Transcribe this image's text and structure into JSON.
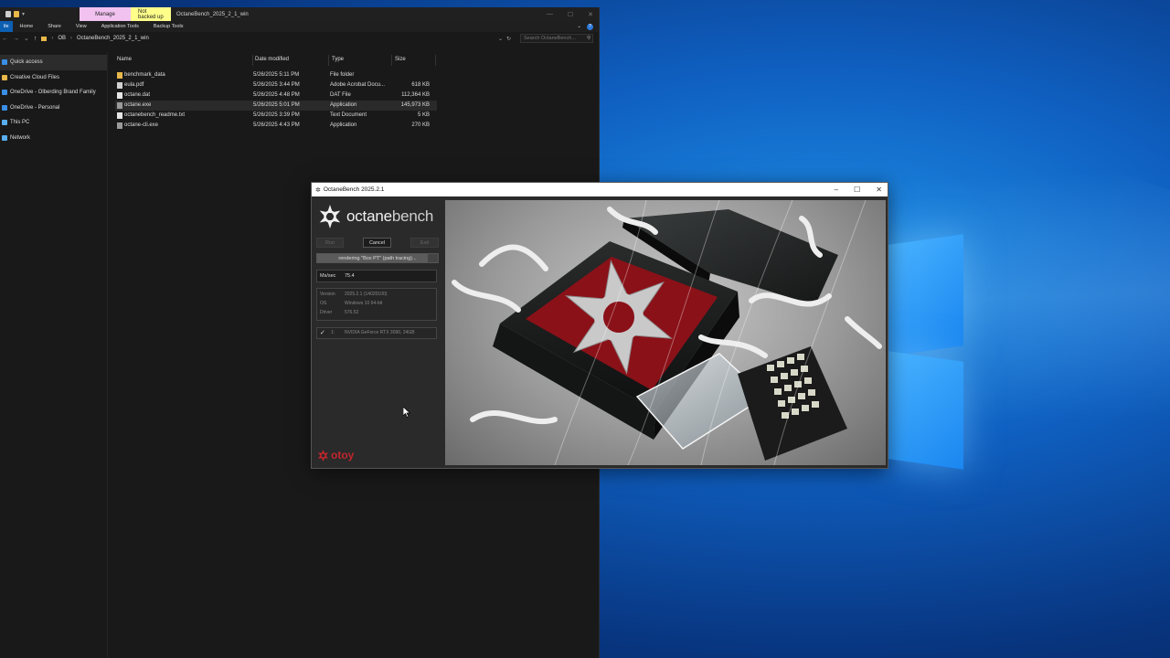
{
  "explorer": {
    "ctx_manage": "Manage",
    "ctx_backup": "Not backed up",
    "window_title": "OctaneBench_2025_2_1_win",
    "ribbon": {
      "file": "ile",
      "tabs": [
        "Home",
        "Share",
        "View",
        "Application Tools",
        "Backup Tools"
      ]
    },
    "address": {
      "root": "OB",
      "folder": "OctaneBench_2025_2_1_win",
      "search_placeholder": "Search OctaneBench..."
    },
    "nav": [
      {
        "label": "Quick access",
        "icon": "star-icon",
        "color": "#3a8ee6"
      },
      {
        "label": "Creative Cloud Files",
        "icon": "folder-icon",
        "color": "#e8b84a"
      },
      {
        "label": "OneDrive - Olberding Brand Family",
        "icon": "cloud-icon",
        "color": "#3a8ee6"
      },
      {
        "label": "OneDrive - Personal",
        "icon": "cloud-icon",
        "color": "#3a8ee6"
      },
      {
        "label": "This PC",
        "icon": "computer-icon",
        "color": "#5aaef0"
      },
      {
        "label": "Network",
        "icon": "network-icon",
        "color": "#5aaef0"
      }
    ],
    "columns": {
      "name": "Name",
      "date": "Date modified",
      "type": "Type",
      "size": "Size"
    },
    "files": [
      {
        "name": "benchmark_data",
        "date": "5/26/2025 5:11 PM",
        "type": "File folder",
        "size": "",
        "icon": "folder-icon",
        "color": "#e8b84a"
      },
      {
        "name": "eula.pdf",
        "date": "5/26/2025 3:44 PM",
        "type": "Adobe Acrobat Docu...",
        "size": "618 KB",
        "icon": "pdf-icon",
        "color": "#d0d0d0"
      },
      {
        "name": "octane.dat",
        "date": "5/26/2025 4:48 PM",
        "type": "DAT File",
        "size": "112,364 KB",
        "icon": "file-icon",
        "color": "#e6e6e6"
      },
      {
        "name": "octane.exe",
        "date": "5/26/2025 5:01 PM",
        "type": "Application",
        "size": "145,973 KB",
        "icon": "app-icon",
        "color": "#9a9a9a"
      },
      {
        "name": "octanebench_readme.txt",
        "date": "5/26/2025 3:39 PM",
        "type": "Text Document",
        "size": "5 KB",
        "icon": "text-file-icon",
        "color": "#e6e6e6"
      },
      {
        "name": "octane-cli.exe",
        "date": "5/26/2025 4:43 PM",
        "type": "Application",
        "size": "270 KB",
        "icon": "app-icon",
        "color": "#9a9a9a"
      }
    ]
  },
  "octane": {
    "title": "OctaneBench 2025.2.1",
    "brand_bold": "octane",
    "brand_light": "bench",
    "buttons": {
      "run": "Run",
      "cancel": "Cancel",
      "exit": "Exit"
    },
    "progress_label": "rendering \"Box PT\" (path tracing)...",
    "progress_fraction": 0.92,
    "ms_label": "Ms/sec",
    "ms_value": "75.4",
    "info": [
      {
        "label": "Version",
        "value": "2025.2.1 (14020100)"
      },
      {
        "label": "OS",
        "value": "Windows 10 64-bit"
      },
      {
        "label": "Driver",
        "value": "576.52"
      }
    ],
    "gpu": {
      "index": "1:",
      "name": "NVIDIA GeForce RTX 3090, 24GB"
    },
    "footer_logo": "otoy"
  }
}
